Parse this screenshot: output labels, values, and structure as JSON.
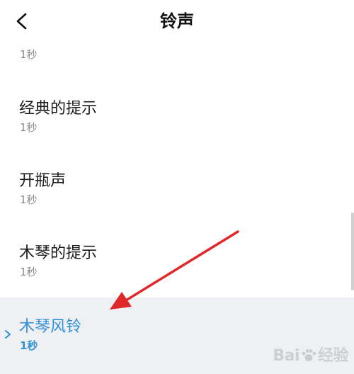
{
  "header": {
    "title": "铃声",
    "back_icon": "chevron-left-icon"
  },
  "ringtones": [
    {
      "name": "",
      "duration": "1秒"
    },
    {
      "name": "经典的提示",
      "duration": "1秒"
    },
    {
      "name": "开瓶声",
      "duration": "1秒"
    },
    {
      "name": "木琴的提示",
      "duration": "1秒"
    },
    {
      "name": "木琴风铃",
      "duration": "1秒",
      "selected": true
    }
  ],
  "colors": {
    "selected_text": "#2f8fd8",
    "selected_bg": "#eef0f3",
    "annotation_arrow": "#e0272a"
  },
  "watermark": {
    "text_left": "Bai",
    "text_right": "经验"
  }
}
